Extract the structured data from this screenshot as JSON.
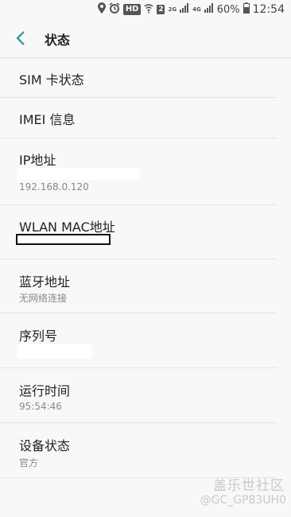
{
  "status_bar": {
    "hd": "HD",
    "sim": "2",
    "net_2g": "2G",
    "net_4g": "4G",
    "battery_pct": "60%",
    "time": "12:54",
    "icons": [
      "location-icon",
      "alarm-icon",
      "wifi-icon",
      "signal-icon",
      "battery-icon"
    ]
  },
  "header": {
    "title": "状态",
    "accent": "#2a8fa0"
  },
  "items": [
    {
      "title": "SIM 卡状态"
    },
    {
      "title": "IMEI 信息"
    },
    {
      "title": "IP地址",
      "value": "192.168.0.120"
    },
    {
      "title": "WLAN MAC地址"
    },
    {
      "title": "蓝牙地址",
      "value": "无网络连接"
    },
    {
      "title": "序列号"
    },
    {
      "title": "运行时间",
      "value": "95:54:46"
    },
    {
      "title": "设备状态",
      "value": "官方"
    }
  ],
  "watermark": {
    "brand": "盖乐世社区",
    "user": "@GC_GP83UH0"
  }
}
